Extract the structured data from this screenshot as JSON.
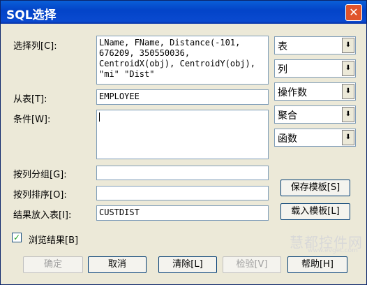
{
  "window": {
    "title": "SQL选择",
    "close_symbol": "✕"
  },
  "labels": {
    "select_columns": "选择列[C]:",
    "from_table": "从表[T]:",
    "where": "条件[W]:",
    "group_by": "按列分组[G]:",
    "order_by": "按列排序[O]:",
    "into_table": "结果放入表[I]:",
    "browse": "浏览结果[B]"
  },
  "fields": {
    "select_columns": "LName, FName, Distance(-101, 676209, 350550036, CentroidX(obj), CentroidY(obj), \"mi\" \"Dist\"",
    "from_table": "EMPLOYEE",
    "where": "",
    "group_by": "",
    "order_by": "",
    "into_table": "CUSTDIST"
  },
  "combos": [
    "表",
    "列",
    "操作数",
    "聚合",
    "函数"
  ],
  "combo_arrow": "⬇",
  "buttons": {
    "save_template": "保存模板[S]",
    "load_template": "载入模板[L]",
    "ok": "确定",
    "cancel": "取消",
    "clear": "清除[L]",
    "verify": "检验[V]",
    "help": "帮助[H]"
  },
  "browse_checked": true,
  "check_mark": "✓",
  "watermark": {
    "text": "慧都控件网",
    "url": "www.evget.com"
  }
}
